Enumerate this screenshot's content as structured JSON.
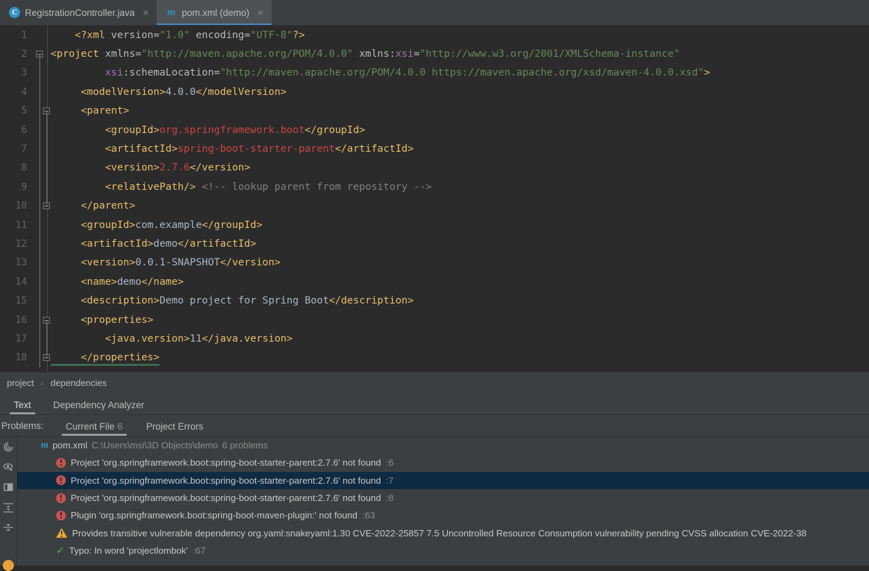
{
  "window": {
    "theme_bg": "#2b2b2b",
    "panel_bg": "#3c3f41",
    "accent": "#4a88c7"
  },
  "tabs": [
    {
      "label": "RegistrationController.java",
      "icon": "java-class-icon",
      "icon_glyph": "C",
      "active": false,
      "close": "×"
    },
    {
      "label": "pom.xml (demo)",
      "icon": "maven-icon",
      "icon_glyph": "m",
      "active": true,
      "close": "×"
    }
  ],
  "editor": {
    "language": "xml",
    "lines": [
      {
        "n": "1",
        "fold": "none",
        "tokens": [
          {
            "t": "    ",
            "c": "t-txt"
          },
          {
            "t": "<?xml",
            "c": "t-tag"
          },
          {
            "t": " version=",
            "c": "t-attr"
          },
          {
            "t": "\"1.0\"",
            "c": "t-val"
          },
          {
            "t": " encoding=",
            "c": "t-attr"
          },
          {
            "t": "\"UTF-8\"",
            "c": "t-val"
          },
          {
            "t": "?>",
            "c": "t-tag"
          }
        ]
      },
      {
        "n": "2",
        "fold": "start",
        "tokens": [
          {
            "t": "<project",
            "c": "t-tag"
          },
          {
            "t": " xmlns=",
            "c": "t-attr"
          },
          {
            "t": "\"http://maven.apache.org/POM/4.0.0\"",
            "c": "t-val"
          },
          {
            "t": " xmlns:",
            "c": "t-attr"
          },
          {
            "t": "xsi",
            "c": "t-ns"
          },
          {
            "t": "=",
            "c": "t-attr"
          },
          {
            "t": "\"http://www.w3.org/2001/XMLSchema-instance\"",
            "c": "t-val"
          }
        ]
      },
      {
        "n": "3",
        "fold": "line",
        "tokens": [
          {
            "t": "         ",
            "c": "t-txt"
          },
          {
            "t": "xsi",
            "c": "t-ns"
          },
          {
            "t": ":schemaLocation=",
            "c": "t-attr"
          },
          {
            "t": "\"http://maven.apache.org/POM/4.0.0 https://maven.apache.org/xsd/maven-4.0.0.xsd\"",
            "c": "t-val"
          },
          {
            "t": ">",
            "c": "t-tag"
          }
        ]
      },
      {
        "n": "4",
        "fold": "line",
        "tokens": [
          {
            "t": "     ",
            "c": "t-txt"
          },
          {
            "t": "<modelVersion>",
            "c": "t-tag"
          },
          {
            "t": "4.0.0",
            "c": "t-txt"
          },
          {
            "t": "</modelVersion>",
            "c": "t-tag"
          }
        ]
      },
      {
        "n": "5",
        "fold": "start2",
        "tokens": [
          {
            "t": "     ",
            "c": "t-txt"
          },
          {
            "t": "<parent>",
            "c": "t-tag"
          }
        ]
      },
      {
        "n": "6",
        "fold": "line2",
        "tokens": [
          {
            "t": "         ",
            "c": "t-txt"
          },
          {
            "t": "<groupId>",
            "c": "t-tag"
          },
          {
            "t": "org.springframework.boot",
            "c": "t-err"
          },
          {
            "t": "</groupId>",
            "c": "t-tag"
          }
        ]
      },
      {
        "n": "7",
        "fold": "line2",
        "tokens": [
          {
            "t": "         ",
            "c": "t-txt"
          },
          {
            "t": "<artifactId>",
            "c": "t-tag"
          },
          {
            "t": "spring-boot-starter-parent",
            "c": "t-err"
          },
          {
            "t": "</artifactId>",
            "c": "t-tag"
          }
        ]
      },
      {
        "n": "8",
        "fold": "line2",
        "tokens": [
          {
            "t": "         ",
            "c": "t-txt"
          },
          {
            "t": "<version>",
            "c": "t-tag"
          },
          {
            "t": "2.7.6",
            "c": "t-err"
          },
          {
            "t": "</version>",
            "c": "t-tag"
          }
        ]
      },
      {
        "n": "9",
        "fold": "line2",
        "tokens": [
          {
            "t": "         ",
            "c": "t-txt"
          },
          {
            "t": "<relativePath/>",
            "c": "t-tag"
          },
          {
            "t": " <!-- lookup parent from repository -->",
            "c": "t-com"
          }
        ]
      },
      {
        "n": "10",
        "fold": "end2",
        "tokens": [
          {
            "t": "     ",
            "c": "t-txt"
          },
          {
            "t": "</parent>",
            "c": "t-tag"
          }
        ]
      },
      {
        "n": "11",
        "fold": "line",
        "tokens": [
          {
            "t": "     ",
            "c": "t-txt"
          },
          {
            "t": "<groupId>",
            "c": "t-tag"
          },
          {
            "t": "com.example",
            "c": "t-txt"
          },
          {
            "t": "</groupId>",
            "c": "t-tag"
          }
        ]
      },
      {
        "n": "12",
        "fold": "line",
        "tokens": [
          {
            "t": "     ",
            "c": "t-txt"
          },
          {
            "t": "<artifactId>",
            "c": "t-tag"
          },
          {
            "t": "demo",
            "c": "t-txt"
          },
          {
            "t": "</artifactId>",
            "c": "t-tag"
          }
        ]
      },
      {
        "n": "13",
        "fold": "line",
        "tokens": [
          {
            "t": "     ",
            "c": "t-txt"
          },
          {
            "t": "<version>",
            "c": "t-tag"
          },
          {
            "t": "0.0.1-SNAPSHOT",
            "c": "t-txt"
          },
          {
            "t": "</version>",
            "c": "t-tag"
          }
        ]
      },
      {
        "n": "14",
        "fold": "line",
        "tokens": [
          {
            "t": "     ",
            "c": "t-txt"
          },
          {
            "t": "<name>",
            "c": "t-tag"
          },
          {
            "t": "demo",
            "c": "t-txt"
          },
          {
            "t": "</name>",
            "c": "t-tag"
          }
        ]
      },
      {
        "n": "15",
        "fold": "line",
        "tokens": [
          {
            "t": "     ",
            "c": "t-txt"
          },
          {
            "t": "<description>",
            "c": "t-tag"
          },
          {
            "t": "Demo project for Spring Boot",
            "c": "t-txt"
          },
          {
            "t": "</description>",
            "c": "t-tag"
          }
        ]
      },
      {
        "n": "16",
        "fold": "start2",
        "tokens": [
          {
            "t": "     ",
            "c": "t-txt"
          },
          {
            "t": "<properties>",
            "c": "t-tag"
          }
        ]
      },
      {
        "n": "17",
        "fold": "line2",
        "tokens": [
          {
            "t": "         ",
            "c": "t-txt"
          },
          {
            "t": "<java.version>",
            "c": "t-tag"
          },
          {
            "t": "11",
            "c": "t-txt"
          },
          {
            "t": "</java.version>",
            "c": "t-tag"
          }
        ]
      },
      {
        "n": "18",
        "fold": "end2",
        "underline": true,
        "tokens": [
          {
            "t": "     ",
            "c": "t-txt"
          },
          {
            "t": "</properties>",
            "c": "t-tag"
          }
        ]
      }
    ]
  },
  "breadcrumb": {
    "items": [
      "project",
      "dependencies"
    ],
    "separator": "›"
  },
  "editor_tabs": [
    {
      "label": "Text",
      "active": true
    },
    {
      "label": "Dependency Analyzer",
      "active": false
    }
  ],
  "problems_panel": {
    "title": "Problems:",
    "tabs": [
      {
        "label": "Current File",
        "count": "6",
        "active": true
      },
      {
        "label": "Project Errors",
        "count": "",
        "active": false
      }
    ],
    "sidebar_icons": [
      "inspections-icon",
      "eye-visibility-icon",
      "layout-panel-icon",
      "sort-icon",
      "collapse-all-icon",
      "status-dot-icon"
    ],
    "file_row": {
      "icon": "maven-icon",
      "name": "pom.xml",
      "path": "C:\\Users\\msi\\3D Objects\\demo",
      "count": "6 problems"
    },
    "rows": [
      {
        "severity": "error",
        "icon": "error-icon",
        "text": "Project 'org.springframework.boot:spring-boot-starter-parent:2.7.6' not found",
        "line": ":6",
        "selected": false
      },
      {
        "severity": "error",
        "icon": "error-icon",
        "text": "Project 'org.springframework.boot:spring-boot-starter-parent:2.7.6' not found",
        "line": ":7",
        "selected": true
      },
      {
        "severity": "error",
        "icon": "error-icon",
        "text": "Project 'org.springframework.boot:spring-boot-starter-parent:2.7.6' not found",
        "line": ":8",
        "selected": false
      },
      {
        "severity": "error",
        "icon": "error-icon",
        "text": "Plugin 'org.springframework.boot:spring-boot-maven-plugin:' not found",
        "line": ":63",
        "selected": false
      },
      {
        "severity": "warning",
        "icon": "warning-icon",
        "text": "Provides transitive vulnerable dependency org.yaml:snakeyaml:1.30 CVE-2022-25857 7.5 Uncontrolled Resource Consumption vulnerability pending CVSS allocation CVE-2022-38",
        "line": "",
        "selected": false
      },
      {
        "severity": "typo",
        "icon": "typo-icon",
        "text": "Typo: In word 'projectlombok'",
        "line": ":67",
        "selected": false
      }
    ]
  }
}
